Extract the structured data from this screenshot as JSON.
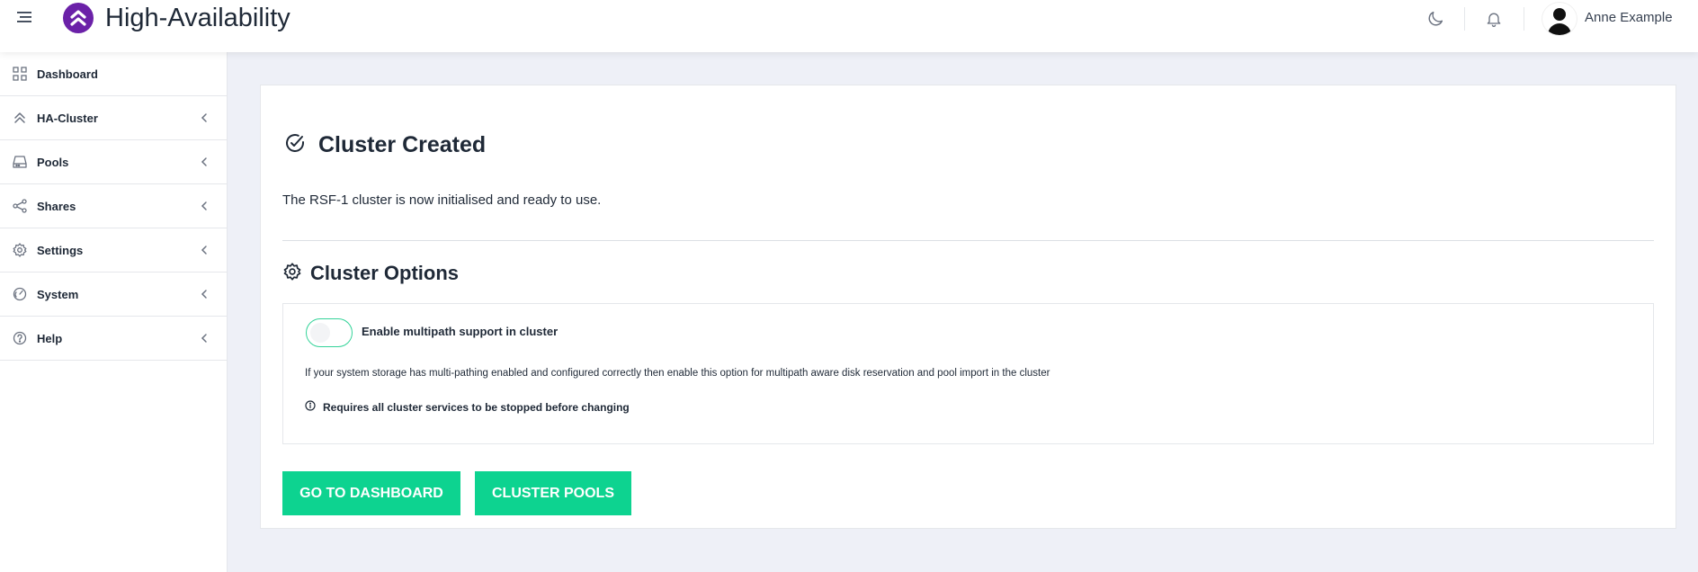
{
  "header": {
    "app_title": "High-Availability",
    "user_name": "Anne Example"
  },
  "sidebar": {
    "items": [
      {
        "label": "Dashboard",
        "icon": "grid-icon"
      },
      {
        "label": "HA-Cluster",
        "icon": "double-chevron-up-icon"
      },
      {
        "label": "Pools",
        "icon": "drive-icon"
      },
      {
        "label": "Shares",
        "icon": "share-icon"
      },
      {
        "label": "Settings",
        "icon": "gear-icon"
      },
      {
        "label": "System",
        "icon": "gauge-icon"
      },
      {
        "label": "Help",
        "icon": "question-icon"
      }
    ]
  },
  "main": {
    "created_title": "Cluster Created",
    "created_desc": "The RSF-1 cluster is now initialised and ready to use.",
    "options_title": "Cluster Options",
    "multipath_label": "Enable multipath support in cluster",
    "multipath_enabled": false,
    "multipath_help": "If your system storage has multi-pathing enabled and configured correctly then enable this option for multipath aware disk reservation and pool import in the cluster",
    "multipath_warning": "Requires all cluster services to be stopped before changing",
    "btn_dashboard": "GO TO DASHBOARD",
    "btn_pools": "CLUSTER POOLS"
  },
  "colors": {
    "accent": "#0dd390",
    "brand": "#6b21a8",
    "background": "#eef0f7"
  }
}
